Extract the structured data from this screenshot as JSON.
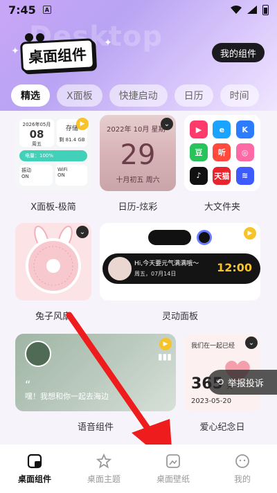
{
  "status": {
    "time": "7:45",
    "app_icon": "A"
  },
  "header": {
    "watermark": "Desktop",
    "logo_text": "桌面组件",
    "my_widgets": "我的组件"
  },
  "tabs": [
    "精选",
    "X面板",
    "快捷启动",
    "日历",
    "时间"
  ],
  "widgets": {
    "x_panel": {
      "label": "X面板-极简",
      "date": "2026年05月",
      "day": "08",
      "weekday": "周五",
      "storage_title": "存储",
      "storage_value": "剩 81.4 GB",
      "battery": "电量：100%",
      "vibrate": "振动",
      "vibrate_state": "ON",
      "wifi": "WiFi",
      "wifi_state": "ON"
    },
    "calendar": {
      "label": "日历-炫彩",
      "header": "2022年 10月 星期",
      "day": "29",
      "lunar": "十月初五 周六"
    },
    "folder": {
      "label": "大文件夹",
      "apps": [
        {
          "name": "video-app",
          "color": "#ff3b6b",
          "glyph": "▶"
        },
        {
          "name": "browser-app",
          "color": "#1aa3ff",
          "glyph": "e"
        },
        {
          "name": "k-app",
          "color": "#2b7cff",
          "glyph": "K"
        },
        {
          "name": "bean-app",
          "color": "#29c35b",
          "glyph": "豆"
        },
        {
          "name": "listen-app",
          "color": "#ff4a3d",
          "glyph": "听"
        },
        {
          "name": "ring-app",
          "color": "#ff6aa6",
          "glyph": "◎"
        },
        {
          "name": "tiktok-app",
          "color": "#111111",
          "glyph": "♪"
        },
        {
          "name": "tmall-app",
          "color": "#e8242d",
          "glyph": "天猫"
        },
        {
          "name": "swirl-app",
          "color": "#3d5bff",
          "glyph": "≋"
        }
      ]
    },
    "fan": {
      "label": "兔子风扇"
    },
    "dynamic": {
      "label": "灵动面板",
      "message": "Hi,今天要元气满满哦～",
      "date": "周五，07月14日",
      "clock": "12:00"
    },
    "voice": {
      "label": "语音组件",
      "quote_mark": "“",
      "text": "嘿！我想和你一起去海边"
    },
    "love": {
      "label": "爱心纪念日",
      "title": "我们在一起已经",
      "days": "365",
      "unit": "天",
      "date": "2023-05-20"
    }
  },
  "report": "举报投诉",
  "nav": [
    {
      "label": "桌面组件",
      "icon": "widget-icon",
      "active": true
    },
    {
      "label": "桌面主题",
      "icon": "star-theme-icon",
      "active": false
    },
    {
      "label": "桌面壁纸",
      "icon": "wallpaper-icon",
      "active": false
    },
    {
      "label": "我的",
      "icon": "smiley-icon",
      "active": false
    }
  ]
}
